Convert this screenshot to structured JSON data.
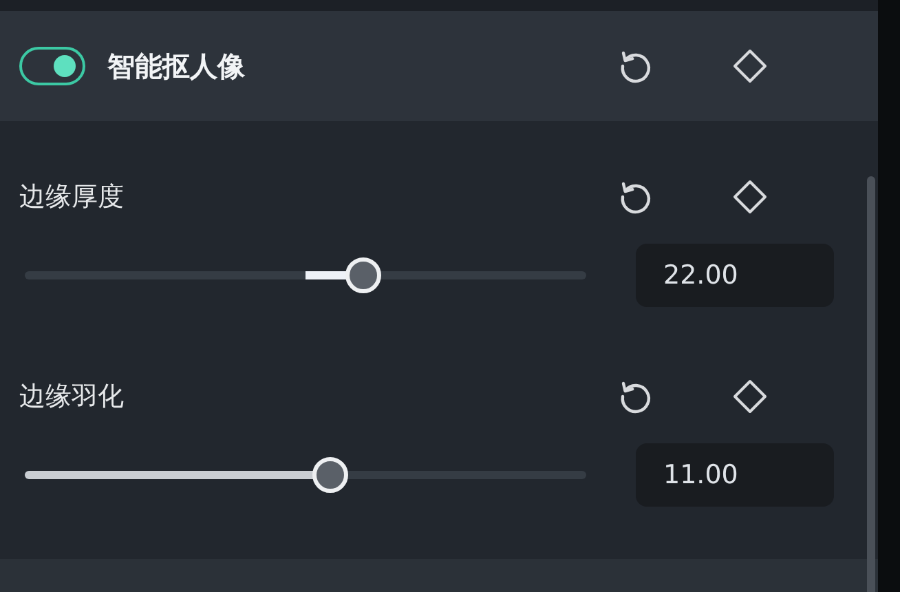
{
  "section": {
    "title": "智能抠人像",
    "on": true
  },
  "params": [
    {
      "kind": "centered",
      "label": "边缘厚度",
      "level": 0.603,
      "value": "22.00"
    },
    {
      "kind": "normal",
      "label": "边缘羽化",
      "level": 0.544,
      "value": "11.00"
    }
  ]
}
